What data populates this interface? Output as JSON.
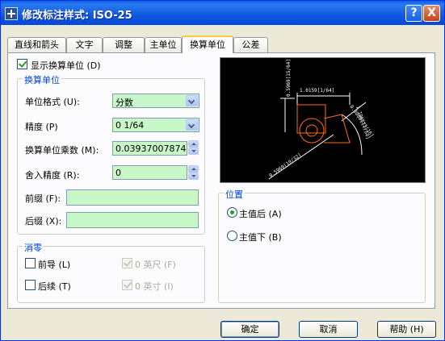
{
  "window": {
    "title": "修改标注样式: ISO-25",
    "help_btn": "?",
    "close_btn": "X"
  },
  "tabs": [
    "直线和箭头",
    "文字",
    "调整",
    "主单位",
    "换算单位",
    "公差"
  ],
  "active_tab": "换算单位",
  "display_alt_units": {
    "label": "显示换算单位 (D)",
    "checked": true
  },
  "alt_units_group": {
    "title": "换算单位",
    "unit_format": {
      "label": "单位格式 (U):",
      "value": "分数"
    },
    "precision": {
      "label": "精度 (P)",
      "value": "0 1/64"
    },
    "multiplier": {
      "label": "换算单位乘数 (M):",
      "value": "0.0393700787401"
    },
    "round_off": {
      "label": "舍入精度 (R):",
      "value": "0"
    },
    "prefix": {
      "label": "前缀 (F):",
      "value": ""
    },
    "suffix": {
      "label": "后缀 (X):",
      "value": ""
    }
  },
  "zero_suppression": {
    "title": "消零",
    "leading": {
      "label": "前导 (L)",
      "checked": false
    },
    "trailing": {
      "label": "后续 (T)",
      "checked": false
    },
    "feet": {
      "label": "0 英尺 (F)",
      "checked": true,
      "disabled": true
    },
    "inches": {
      "label": "0 英寸 (I)",
      "checked": true,
      "disabled": true
    }
  },
  "placement": {
    "title": "位置",
    "after_primary": {
      "label": "主值后 (A)",
      "checked": true
    },
    "below_primary": {
      "label": "主值下 (B)",
      "checked": false
    }
  },
  "preview": {
    "dims": [
      "0.5969[15/64]",
      "1.0159[1/64]",
      "0.8008[13/16]",
      "1.1965[1/64]",
      "0.5969[19/32]"
    ],
    "colors": {
      "background": "#000000",
      "lines": "#ffffff",
      "shape": "#ff6a1a"
    }
  },
  "buttons": {
    "ok": "确定",
    "cancel": "取消",
    "help": "帮助 (H)"
  }
}
